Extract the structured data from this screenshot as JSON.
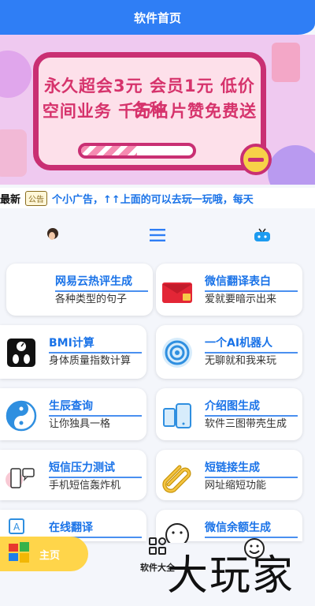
{
  "header": {
    "title": "软件首页"
  },
  "banner": {
    "line1": "永久超会3元 会员1元 低价各种",
    "line2": "空间业务 千万名片赞免费送"
  },
  "notice": {
    "prefix": "最新",
    "badge": "公告",
    "text": "个小广告，↑↑上面的可以去玩一玩哦，每天"
  },
  "quick_nav": {
    "items": [
      {
        "icon": "avatar-icon"
      },
      {
        "icon": "menu-icon"
      },
      {
        "icon": "tv-icon"
      }
    ]
  },
  "tools": [
    {
      "title": "网易云热评生成",
      "desc": "各种类型的句子",
      "icon": "music-icon"
    },
    {
      "title": "微信翻译表白",
      "desc": "爱就要暗示出来",
      "icon": "red-envelope-icon"
    },
    {
      "title": "BMI计算",
      "desc": "身体质量指数计算",
      "icon": "scale-icon"
    },
    {
      "title": "一个AI机器人",
      "desc": "无聊就和我来玩",
      "icon": "target-icon"
    },
    {
      "title": "生辰查询",
      "desc": "让你独具一格",
      "icon": "yin-yang-icon"
    },
    {
      "title": "介绍图生成",
      "desc": "软件三图带壳生成",
      "icon": "phone-icon"
    },
    {
      "title": "短信压力测试",
      "desc": "手机短信轰炸机",
      "icon": "message-icon"
    },
    {
      "title": "短链接生成",
      "desc": "网址缩短功能",
      "icon": "paperclip-icon"
    },
    {
      "title": "在线翻译",
      "desc": "",
      "icon": "translate-icon"
    },
    {
      "title": "微信余额生成",
      "desc": "",
      "icon": "smile-icon"
    }
  ],
  "tabbar": {
    "home_label": "主页",
    "all_label": "软件大全"
  },
  "watermark": {
    "text": "大玩家"
  },
  "colors": {
    "primary": "#2f7ef5",
    "accent": "#1a73e8",
    "banner_pink": "#c92f73",
    "home_tab": "#ffd54a"
  }
}
